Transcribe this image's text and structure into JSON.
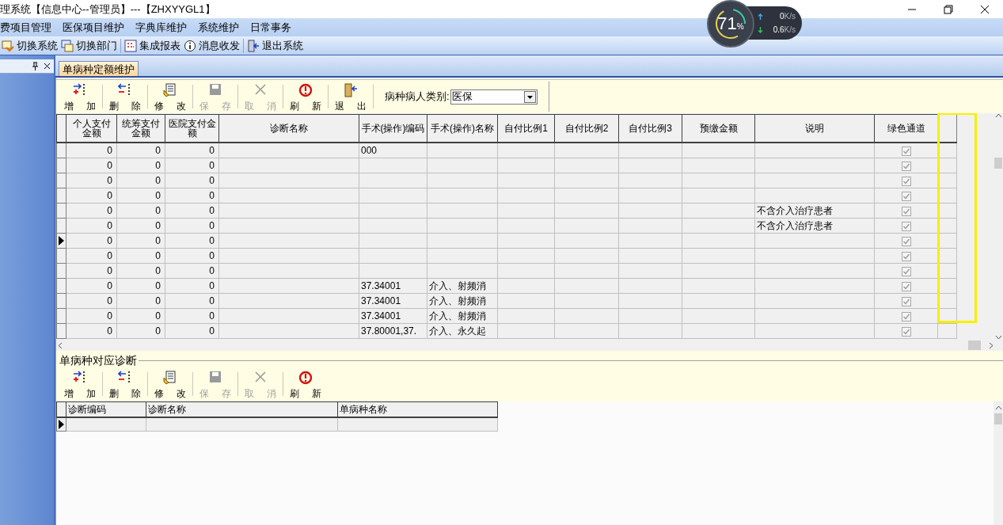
{
  "window": {
    "title": "理系统【信息中心--管理员】---【ZHXYYGL1】"
  },
  "monitor": {
    "percent": "71",
    "percent_sign": "%",
    "upload": {
      "value": "0",
      "unit": "K/s"
    },
    "download": {
      "value": "0.6",
      "unit": "K/s"
    }
  },
  "menu": [
    {
      "label": "费项目管理"
    },
    {
      "label": "医保项目维护"
    },
    {
      "label": "字典库维护"
    },
    {
      "label": "系统维护"
    },
    {
      "label": "日常事务"
    }
  ],
  "toolbar": [
    {
      "label": "切换系统",
      "kind": "switch"
    },
    {
      "label": "切换部门",
      "kind": "dept"
    },
    {
      "label": "集成报表",
      "kind": "report"
    },
    {
      "label": "消息收发",
      "kind": "info"
    },
    {
      "label": "退出系统",
      "kind": "exit"
    }
  ],
  "tabs": [
    {
      "label": "单病种定额维护",
      "selected": true
    }
  ],
  "main_toolbar": {
    "buttons": [
      {
        "label": "增 加",
        "kind": "add",
        "disabled": false
      },
      {
        "label": "删 除",
        "kind": "delete",
        "disabled": false
      },
      {
        "label": "修 改",
        "kind": "edit",
        "disabled": false
      },
      {
        "label": "保 存",
        "kind": "save",
        "disabled": true
      },
      {
        "label": "取 消",
        "kind": "cancel",
        "disabled": true
      },
      {
        "label": "刷 新",
        "kind": "refresh",
        "disabled": false
      },
      {
        "label": "退 出",
        "kind": "exit",
        "disabled": false
      }
    ],
    "filter": {
      "label": "病种病人类别:",
      "value": "医保"
    }
  },
  "table": {
    "columns": [
      {
        "label": "个人支付金额"
      },
      {
        "label": "统筹支付金额"
      },
      {
        "label": "医院支付金额"
      },
      {
        "label": "诊断名称"
      },
      {
        "label": "手术(操作)编码"
      },
      {
        "label": "手术(操作)名称"
      },
      {
        "label": "自付比例1"
      },
      {
        "label": "自付比例2"
      },
      {
        "label": "自付比例3"
      },
      {
        "label": "预缴金额"
      },
      {
        "label": "说明"
      },
      {
        "label": "绿色通道",
        "kind": "checkbox"
      }
    ],
    "rows": [
      {
        "selected": false,
        "cells": {
          "personal": "0",
          "pooled": "0",
          "hospital": "0",
          "op_code": "000"
        },
        "green_checked": true
      },
      {
        "selected": false,
        "cells": {
          "personal": "0",
          "pooled": "0",
          "hospital": "0"
        },
        "green_checked": true
      },
      {
        "selected": false,
        "cells": {
          "personal": "0",
          "pooled": "0",
          "hospital": "0"
        },
        "green_checked": true
      },
      {
        "selected": false,
        "cells": {
          "personal": "0",
          "pooled": "0",
          "hospital": "0"
        },
        "green_checked": true
      },
      {
        "selected": false,
        "cells": {
          "personal": "0",
          "pooled": "0",
          "hospital": "0",
          "note": "不含介入治疗患者"
        },
        "green_checked": true
      },
      {
        "selected": false,
        "cells": {
          "personal": "0",
          "pooled": "0",
          "hospital": "0",
          "note": "不含介入治疗患者"
        },
        "green_checked": true
      },
      {
        "selected": true,
        "cells": {
          "personal": "0",
          "pooled": "0",
          "hospital": "0"
        },
        "green_checked": true
      },
      {
        "selected": false,
        "cells": {
          "personal": "0",
          "pooled": "0",
          "hospital": "0"
        },
        "green_checked": true
      },
      {
        "selected": false,
        "cells": {
          "personal": "0",
          "pooled": "0",
          "hospital": "0"
        },
        "green_checked": true
      },
      {
        "selected": false,
        "cells": {
          "personal": "0",
          "pooled": "0",
          "hospital": "0",
          "op_code": "37.34001",
          "op_name": "介入、射频消"
        },
        "green_checked": true
      },
      {
        "selected": false,
        "cells": {
          "personal": "0",
          "pooled": "0",
          "hospital": "0",
          "op_code": "37.34001",
          "op_name": "介入、射频消"
        },
        "green_checked": true
      },
      {
        "selected": false,
        "cells": {
          "personal": "0",
          "pooled": "0",
          "hospital": "0",
          "op_code": "37.34001",
          "op_name": "介入、射频消"
        },
        "green_checked": true
      },
      {
        "selected": false,
        "cells": {
          "personal": "0",
          "pooled": "0",
          "hospital": "0",
          "op_code": "37.80001,37.",
          "op_name": "介入、永久起"
        },
        "green_checked": true
      }
    ]
  },
  "diagnosis_section": {
    "title": "单病种对应诊断",
    "buttons": [
      {
        "label": "增 加",
        "kind": "add",
        "disabled": false
      },
      {
        "label": "删 除",
        "kind": "delete",
        "disabled": false
      },
      {
        "label": "修 改",
        "kind": "edit",
        "disabled": false
      },
      {
        "label": "保 存",
        "kind": "save",
        "disabled": true
      },
      {
        "label": "取 消",
        "kind": "cancel",
        "disabled": true
      },
      {
        "label": "刷 新",
        "kind": "refresh",
        "disabled": false
      }
    ],
    "table": {
      "columns": [
        {
          "label": "诊断编码"
        },
        {
          "label": "诊断名称"
        },
        {
          "label": "单病种名称"
        }
      ],
      "rows": [
        {
          "selected": true
        }
      ]
    }
  }
}
